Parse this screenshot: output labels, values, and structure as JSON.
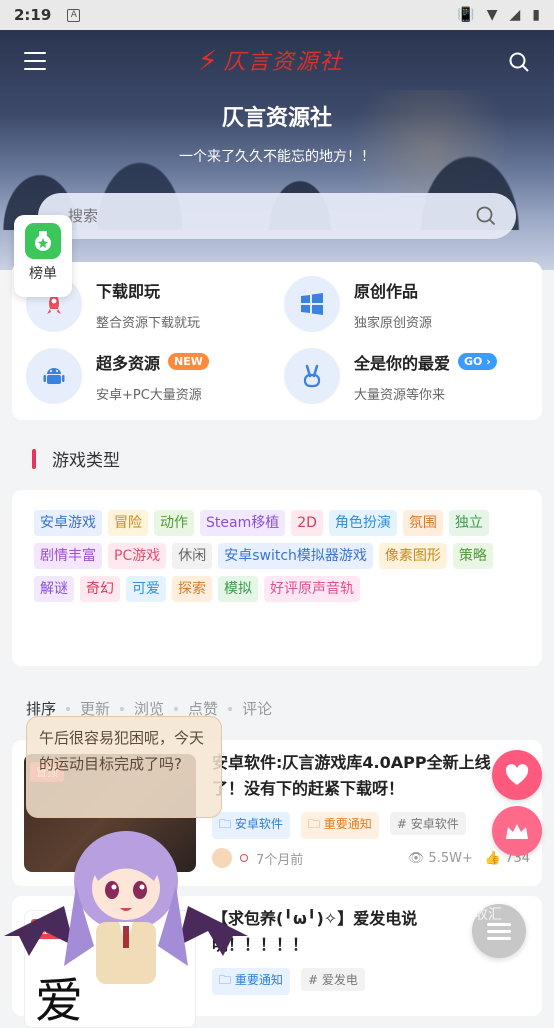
{
  "status_bar": {
    "time": "2:19",
    "notif_icon_letter": "A"
  },
  "header": {
    "logo_text": "仄言资源社",
    "site_title": "仄言资源社",
    "site_subtitle": "一个来了久久不能忘的地方！！",
    "search_placeholder": "搜索"
  },
  "rank_button": {
    "label": "榜单"
  },
  "features": [
    {
      "title": "下载即玩",
      "desc": "整合资源下载就玩",
      "icon": "rocket-icon",
      "badge": ""
    },
    {
      "title": "原创作品",
      "desc": "独家原创资源",
      "icon": "windows-icon",
      "badge": ""
    },
    {
      "title": "超多资源",
      "desc": "安卓+PC大量资源",
      "icon": "android-icon",
      "badge": "NEW"
    },
    {
      "title": "全是你的最爱",
      "desc": "大量资源等你来",
      "icon": "peace-hand-icon",
      "badge": "GO"
    }
  ],
  "game_types": {
    "title": "游戏类型",
    "tags": [
      {
        "label": "安卓游戏",
        "bg": "#e8f0ff",
        "fg": "#3a73d0"
      },
      {
        "label": "冒险",
        "bg": "#fff3dc",
        "fg": "#c98a16"
      },
      {
        "label": "动作",
        "bg": "#eaf6e4",
        "fg": "#4f9a3a"
      },
      {
        "label": "Steam移植",
        "bg": "#f2e8ff",
        "fg": "#8a4fd6"
      },
      {
        "label": "2D",
        "bg": "#ffe8ee",
        "fg": "#d63a5e"
      },
      {
        "label": "角色扮演",
        "bg": "#e4f3ff",
        "fg": "#2f8fd8"
      },
      {
        "label": "氛围",
        "bg": "#ffeedd",
        "fg": "#d9792a"
      },
      {
        "label": "独立",
        "bg": "#e6f6e6",
        "fg": "#3d9a4f"
      },
      {
        "label": "剧情丰富",
        "bg": "#f4e6ff",
        "fg": "#9a4fd0"
      },
      {
        "label": "PC游戏",
        "bg": "#ffe9ef",
        "fg": "#e0506e"
      },
      {
        "label": "休闲",
        "bg": "#f1f1f1",
        "fg": "#666666"
      },
      {
        "label": "安卓switch模拟器游戏",
        "bg": "#e8f0ff",
        "fg": "#3a73d0"
      },
      {
        "label": "像素图形",
        "bg": "#fff2dc",
        "fg": "#c98a16"
      },
      {
        "label": "策略",
        "bg": "#eaf6e4",
        "fg": "#4f9a3a"
      },
      {
        "label": "解谜",
        "bg": "#f2e8ff",
        "fg": "#8a4fd6"
      },
      {
        "label": "奇幻",
        "bg": "#ffe8ee",
        "fg": "#d63a5e"
      },
      {
        "label": "可爱",
        "bg": "#e4f3ff",
        "fg": "#2f8fd8"
      },
      {
        "label": "探索",
        "bg": "#ffeedd",
        "fg": "#d9792a"
      },
      {
        "label": "模拟",
        "bg": "#e6f6e6",
        "fg": "#3d9a4f"
      },
      {
        "label": "好评原声音轨",
        "bg": "#ffe8f4",
        "fg": "#e0508e"
      }
    ]
  },
  "sort_bar": {
    "label": "排序",
    "options": [
      "更新",
      "浏览",
      "点赞",
      "评论"
    ]
  },
  "posts": [
    {
      "badge": "置顶",
      "title": "安卓软件:仄言游戏库4.0APP全新上线了！没有下的赶紧下载呀！",
      "tags": [
        {
          "label": "安卓软件",
          "style": "blue",
          "prefix": "folder"
        },
        {
          "label": "重要通知",
          "style": "orange",
          "prefix": "folder"
        },
        {
          "label": "安卓软件",
          "style": "gray",
          "prefix": "#"
        }
      ],
      "time": "7个月前",
      "views": "5.5W+",
      "likes": "734"
    },
    {
      "badge": "置顶",
      "title": "【求包养(╹ω╹)✧】爱发电说明！！！！！",
      "tags": [
        {
          "label": "重要通知",
          "style": "blue",
          "prefix": "folder"
        },
        {
          "label": "爱发电",
          "style": "gray",
          "prefix": "#"
        }
      ],
      "thumb_text": "爱"
    }
  ],
  "mascot_bubble": "午后很容易犯困呢，今天的运动目标完成了吗?",
  "watermark": "收汇"
}
